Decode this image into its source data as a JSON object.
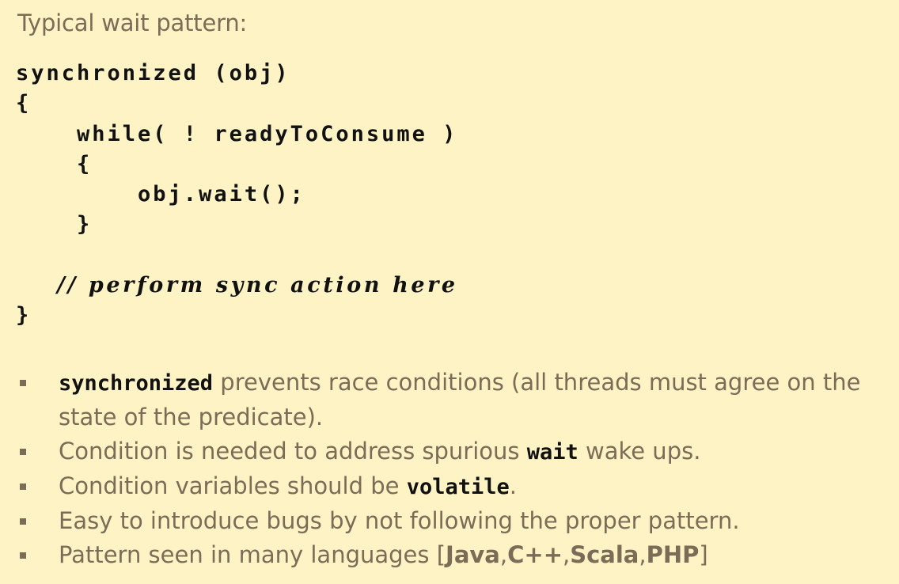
{
  "heading": "Typical wait pattern:",
  "code": {
    "line1": "synchronized (obj)",
    "line2": "{",
    "line3": "    while( ! readyToConsume )",
    "line4": "    {",
    "line5": "        obj.wait();",
    "line6": "    }",
    "line7": "",
    "line8": "    // perform sync action here",
    "line9": "}"
  },
  "bullets": [
    {
      "code": "synchronized",
      "text": " prevents race conditions (all threads must agree on the state of the predicate)."
    },
    {
      "before": "Condition is needed to address spurious ",
      "code": "wait",
      "after": " wake ups."
    },
    {
      "before": "Condition variables should be ",
      "code": "volatile",
      "after": "."
    },
    {
      "text": "Easy to introduce bugs by not following the proper pattern."
    },
    {
      "before": "Pattern seen in many languages [",
      "lang1": "Java",
      "sep1": ",",
      "lang2": "C++",
      "sep2": ",",
      "lang3": "Scala",
      "sep3": ",",
      "lang4": "PHP",
      "after": "]"
    }
  ],
  "colors": {
    "background": "#fdf3c4",
    "text": "#7a6c56",
    "code": "#111111"
  }
}
